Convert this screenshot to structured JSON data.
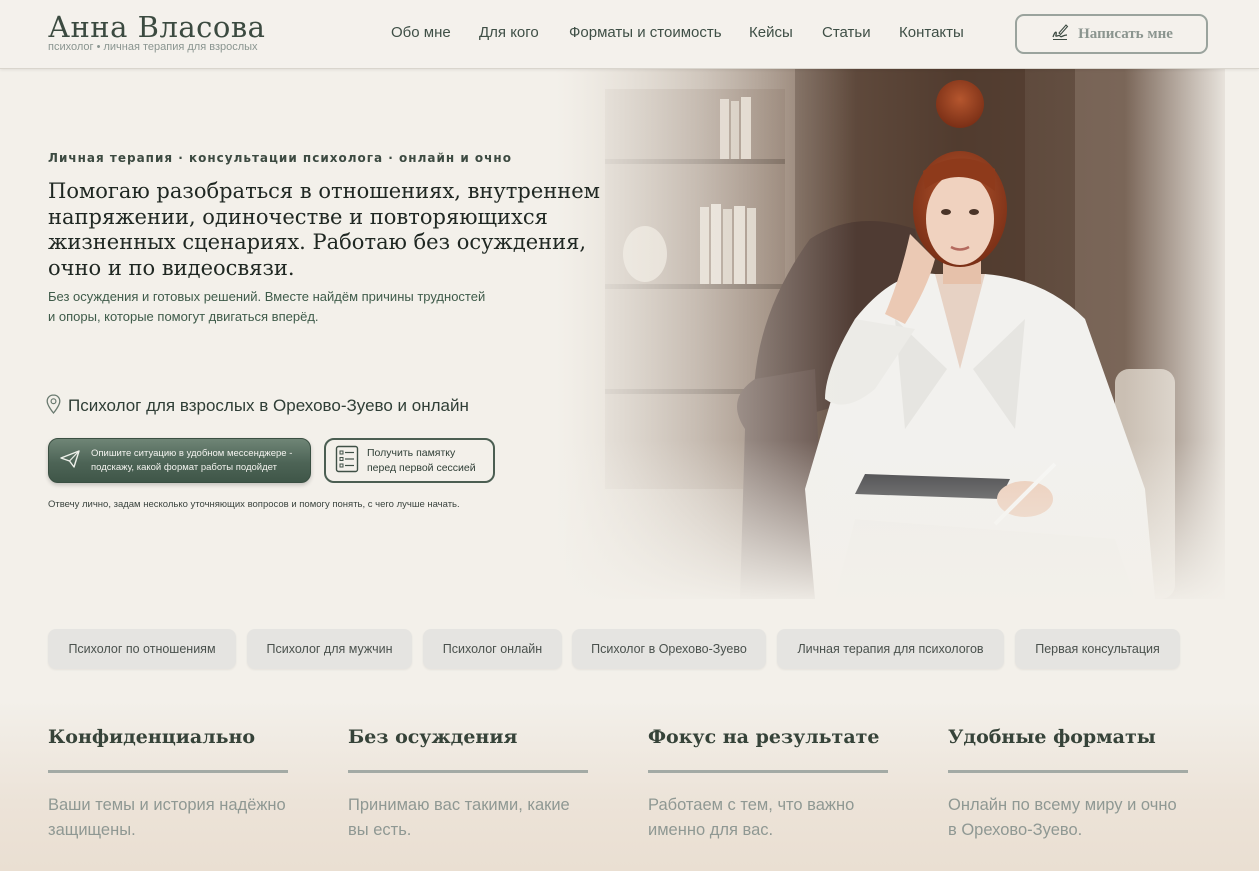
{
  "header": {
    "logo_name": "Анна Власова",
    "logo_sub": "психолог • личная терапия для взрослых",
    "nav": [
      "Обо мне",
      "Для кого",
      "Форматы и стоимость",
      "Кейсы",
      "Статьи",
      "Контакты"
    ],
    "cta_label": "Написать мне",
    "cta_icon": "pen-signature-icon"
  },
  "hero": {
    "eyebrow": "Личная терапия · консультации психолога · онлайн и очно",
    "headline": "Помогаю разобраться в отношениях, внутреннем напряжении, одиночестве и повторяющихся жизненных сценариях. Работаю без осуждения, очно и по видеосвязи.",
    "subline_1": "Без осуждения и готовых решений. Вместе найдём причины трудностей",
    "subline_2": "и опоры, которые помогут двигаться вперёд.",
    "location": "Психолог для взрослых в Орехово-Зуево и онлайн",
    "location_icon": "map-pin-icon",
    "primary_cta": "Опишите ситуацию в удобном мессенджере - подскажу, какой формат работы подойдет",
    "primary_cta_icon": "paper-plane-icon",
    "secondary_cta_1": "Получить памятку",
    "secondary_cta_2": "перед первой сессией",
    "secondary_cta_icon": "checklist-icon",
    "note": "Отвечу лично, задам несколько уточняющих вопросов и помогу понять, с чего лучше начать."
  },
  "chips": [
    "Психолог по отношениям",
    "Психолог для мужчин",
    "Психолог онлайн",
    "Психолог в Орехово-Зуево",
    "Личная терапия для психологов",
    "Первая консультация"
  ],
  "features": [
    {
      "title": "Конфиденциально",
      "text": "Ваши темы и история надёжно защищены."
    },
    {
      "title": "Без осуждения",
      "text": "Принимаю вас такими, какие вы есть."
    },
    {
      "title": "Фокус на результате",
      "text": "Работаем с тем, что важно именно для вас."
    },
    {
      "title": "Удобные форматы",
      "text": "Онлайн по всему миру и очно в Орехово-Зуево."
    }
  ],
  "colors": {
    "background": "#f3f0ea",
    "accent_green": "#4d6456",
    "heading_dark": "#1f2722",
    "muted_text": "#8f9893",
    "chip_bg": "#e5e4e1"
  }
}
